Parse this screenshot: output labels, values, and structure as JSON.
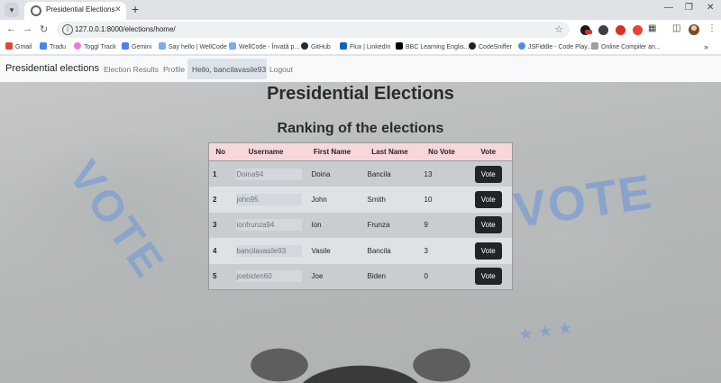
{
  "browser": {
    "tab_title": "Presidential Elections",
    "url": "127.0.0.1:8000/elections/home/",
    "bookmarks": [
      "Gmail",
      "Tradu",
      "Toggl Track",
      "Gemini",
      "Say hello | WellCode",
      "WellCode - Învață p...",
      "GitHub",
      "Flux | LinkedIn",
      "BBC Learning Englis...",
      "CodeSniffer",
      "JSFiddle - Code Play...",
      "Online Compiler an..."
    ],
    "extension_badge_color": "#d93025"
  },
  "navbar": {
    "brand": "Presidential elections",
    "links": [
      "Election Results",
      "Profile"
    ],
    "greeting": "Hello, bancilavasile93",
    "logout": "Logout"
  },
  "page": {
    "title": "Presidential Elections",
    "subtitle": "Ranking of the elections",
    "background_stencil": "VOTE"
  },
  "table": {
    "headers": [
      "No",
      "Username",
      "First Name",
      "Last Name",
      "No Vote",
      "Vote"
    ],
    "rows": [
      {
        "no": "1",
        "username": "Doina94",
        "first_name": "Doina",
        "last_name": "Bancila",
        "votes": "13",
        "action": "Vote"
      },
      {
        "no": "2",
        "username": "john95",
        "first_name": "John",
        "last_name": "Smith",
        "votes": "10",
        "action": "Vote"
      },
      {
        "no": "3",
        "username": "ionfrunza94",
        "first_name": "Ion",
        "last_name": "Frunza",
        "votes": "9",
        "action": "Vote"
      },
      {
        "no": "4",
        "username": "bancilavasile93",
        "first_name": "Vasile",
        "last_name": "Bancila",
        "votes": "3",
        "action": "Vote"
      },
      {
        "no": "5",
        "username": "joebiden60",
        "first_name": "Joe",
        "last_name": "Biden",
        "votes": "0",
        "action": "Vote"
      }
    ]
  },
  "colors": {
    "table_header_bg": "#f8d7da",
    "vote_button_bg": "#212529",
    "stencil_blue": "#7f9fd0"
  }
}
